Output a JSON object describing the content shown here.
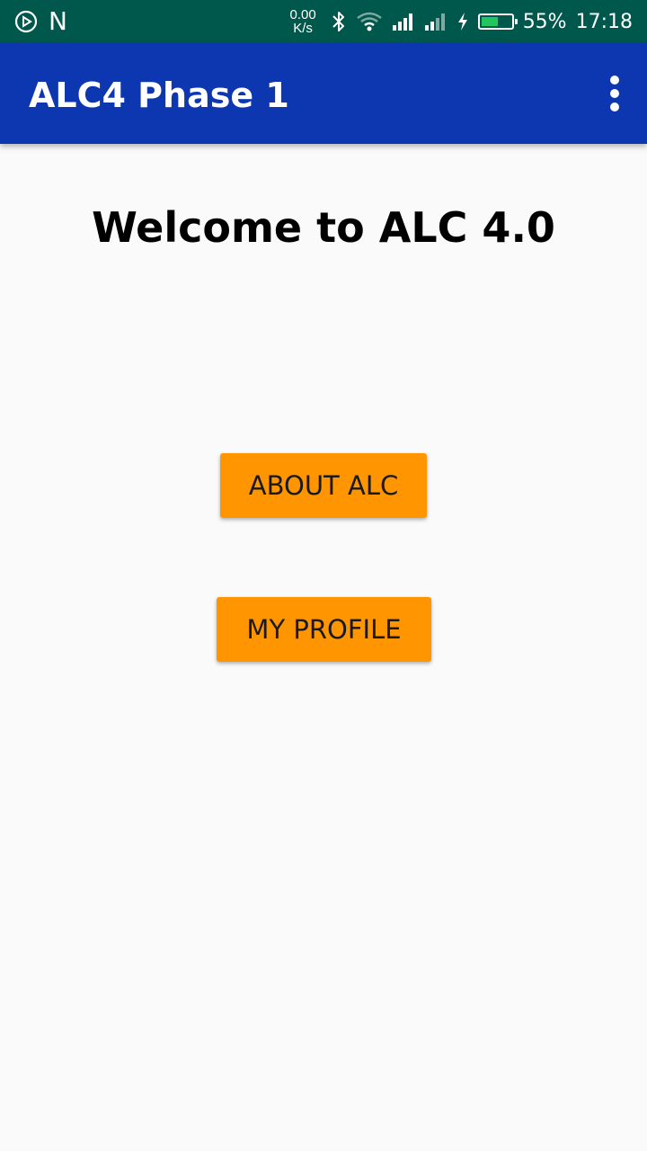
{
  "status_bar": {
    "net_speed_value": "0.00",
    "net_speed_unit": "K/s",
    "battery_percent": "55%",
    "battery_level": 0.55,
    "battery_color": "#22c55e",
    "time": "17:18",
    "carrier_letter": "N",
    "icons": [
      "play-circle-icon",
      "n-icon",
      "bluetooth-icon",
      "wifi-icon",
      "signal-icon",
      "signal-weak-icon",
      "charging-icon",
      "battery-icon"
    ]
  },
  "app_bar": {
    "title": "ALC4 Phase 1",
    "color": "#0d36b1",
    "menu_icon": "more-vert-icon"
  },
  "main": {
    "heading": "Welcome to ALC 4.0",
    "buttons": {
      "about": "ABOUT ALC",
      "profile": "MY PROFILE"
    },
    "button_color": "#ff9500"
  },
  "colors": {
    "status_bar": "#00574b",
    "background": "#fafafa"
  }
}
